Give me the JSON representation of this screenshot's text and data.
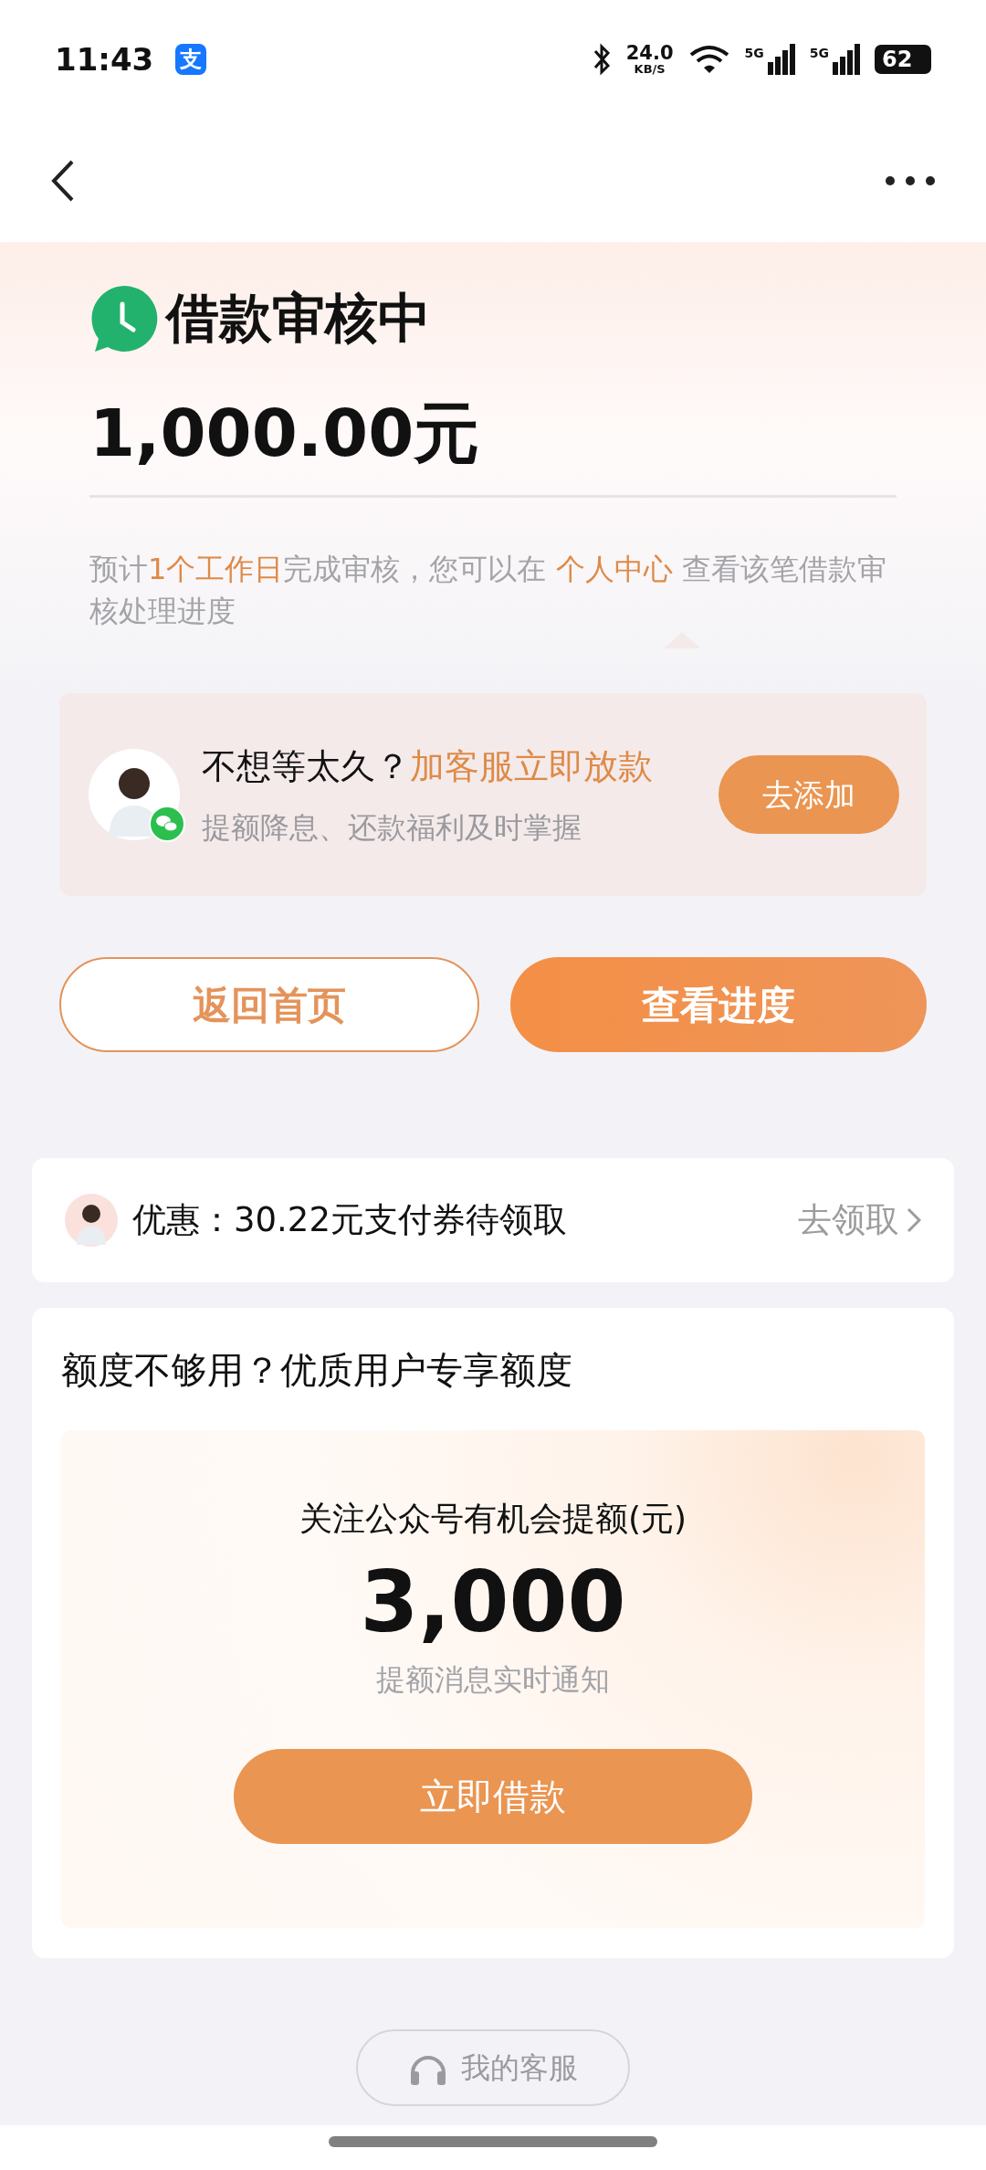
{
  "status_bar": {
    "time": "11:43",
    "app_badge": "支",
    "net_speed": "24.0",
    "net_unit": "KB/S",
    "sim_labels": [
      "5G",
      "5G"
    ],
    "battery": "62"
  },
  "status": {
    "title": "借款审核中",
    "amount": "1,000.00元",
    "notice": [
      {
        "text": "预计",
        "highlight": false
      },
      {
        "text": "1个工作日",
        "highlight": true
      },
      {
        "text": "完成审核，您可以在 ",
        "highlight": false
      },
      {
        "text": "个人中心",
        "highlight": true
      },
      {
        "text": " 查看该笔借款审核处理进度",
        "highlight": false
      }
    ]
  },
  "promo": {
    "title": "不想等太久？",
    "title_highlight": "加客服立即放款",
    "subtitle": "提额降息、还款福利及时掌握",
    "button": "去添加"
  },
  "actions": [
    {
      "label": "返回首页",
      "kind": "outline"
    },
    {
      "label": "查看进度",
      "kind": "filled"
    }
  ],
  "coupon": {
    "text": "优惠：30.22元支付券待领取",
    "link": "去领取"
  },
  "quota": {
    "heading": "额度不够用？优质用户专享额度",
    "caption": "关注公众号有机会提额(元)",
    "amount": "3,000",
    "note": "提额消息实时通知",
    "button": "立即借款"
  },
  "service_button": "我的客服"
}
